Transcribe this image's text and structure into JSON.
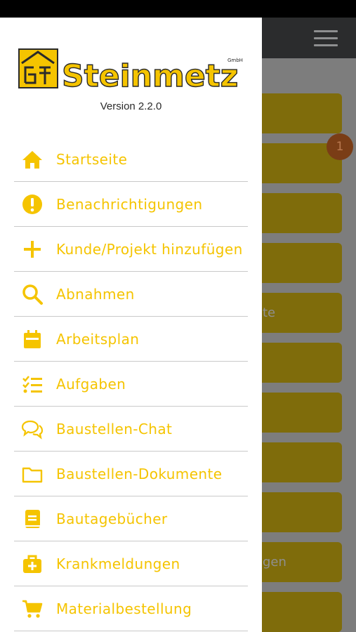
{
  "drawer": {
    "logo_text": "Steinmetz",
    "logo_suffix": "GmbH",
    "version": "Version 2.2.0",
    "accent_color": "#f5c400",
    "items": [
      {
        "label": "Startseite",
        "icon": "home-icon"
      },
      {
        "label": "Benachrichtigungen",
        "icon": "alert-icon"
      },
      {
        "label": "Kunde/Projekt hinzufügen",
        "icon": "plus-icon"
      },
      {
        "label": "Abnahmen",
        "icon": "search-icon"
      },
      {
        "label": "Arbeitsplan",
        "icon": "calendar-icon"
      },
      {
        "label": "Aufgaben",
        "icon": "checklist-icon"
      },
      {
        "label": "Baustellen-Chat",
        "icon": "chat-icon"
      },
      {
        "label": "Baustellen-Dokumente",
        "icon": "folder-icon"
      },
      {
        "label": "Bautagebücher",
        "icon": "book-icon"
      },
      {
        "label": "Krankmeldungen",
        "icon": "medical-kit-icon"
      },
      {
        "label": "Materialbestellung",
        "icon": "cart-icon"
      }
    ]
  },
  "background": {
    "badge_count": "1",
    "partial_label_1": "te",
    "partial_label_2": "gen"
  }
}
